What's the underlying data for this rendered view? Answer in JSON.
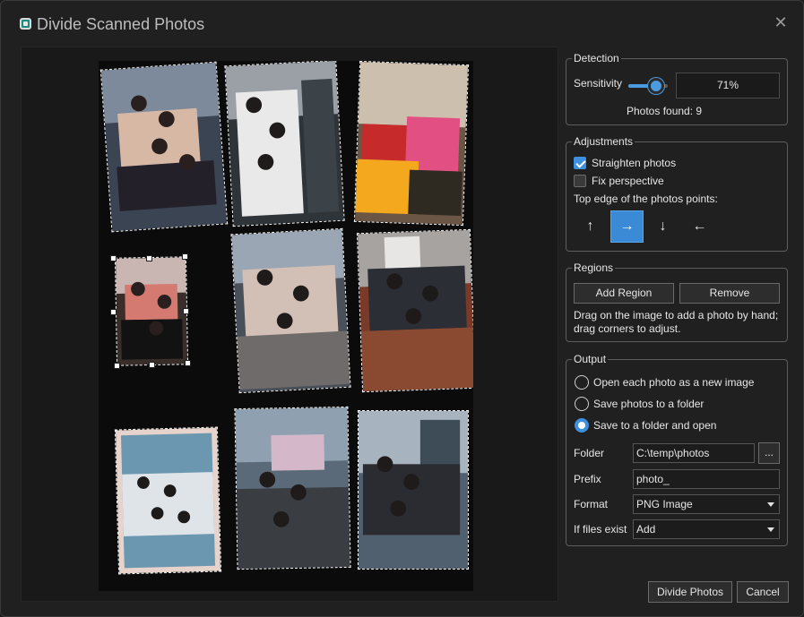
{
  "window": {
    "title": "Divide Scanned Photos",
    "close_glyph": "✕",
    "app_icon": "app-photo-icon"
  },
  "detection": {
    "legend": "Detection",
    "sensitivity_label": "Sensitivity",
    "sensitivity_value": "71%",
    "sensitivity_level": 0.71,
    "photos_found": "Photos found: 9"
  },
  "adjustments": {
    "legend": "Adjustments",
    "straighten_label": "Straighten photos",
    "straighten_checked": true,
    "perspective_label": "Fix perspective",
    "perspective_checked": false,
    "direction_label": "Top edge of the photos points:",
    "directions": [
      {
        "id": "up",
        "glyph": "↑",
        "active": false
      },
      {
        "id": "right",
        "glyph": "→",
        "active": true
      },
      {
        "id": "down",
        "glyph": "↓",
        "active": false
      },
      {
        "id": "left",
        "glyph": "←",
        "active": false
      }
    ]
  },
  "regions": {
    "legend": "Regions",
    "add_label": "Add Region",
    "remove_label": "Remove",
    "note": "Drag on the image to add a photo by hand; drag corners to adjust."
  },
  "output": {
    "legend": "Output",
    "options": [
      {
        "label": "Open each photo as a new image",
        "selected": false
      },
      {
        "label": "Save photos to a folder",
        "selected": false
      },
      {
        "label": "Save to a folder and open",
        "selected": true
      }
    ],
    "folder_label": "Folder",
    "folder_value": "C:\\temp\\photos",
    "browse_label": "...",
    "prefix_label": "Prefix",
    "prefix_value": "photo_",
    "format_label": "Format",
    "format_value": "PNG Image",
    "exists_label": "If files exist",
    "exists_value": "Add"
  },
  "footer": {
    "divide_label": "Divide Photos",
    "cancel_label": "Cancel"
  },
  "colors": {
    "accent": "#3d8fe0",
    "background": "#202020"
  }
}
